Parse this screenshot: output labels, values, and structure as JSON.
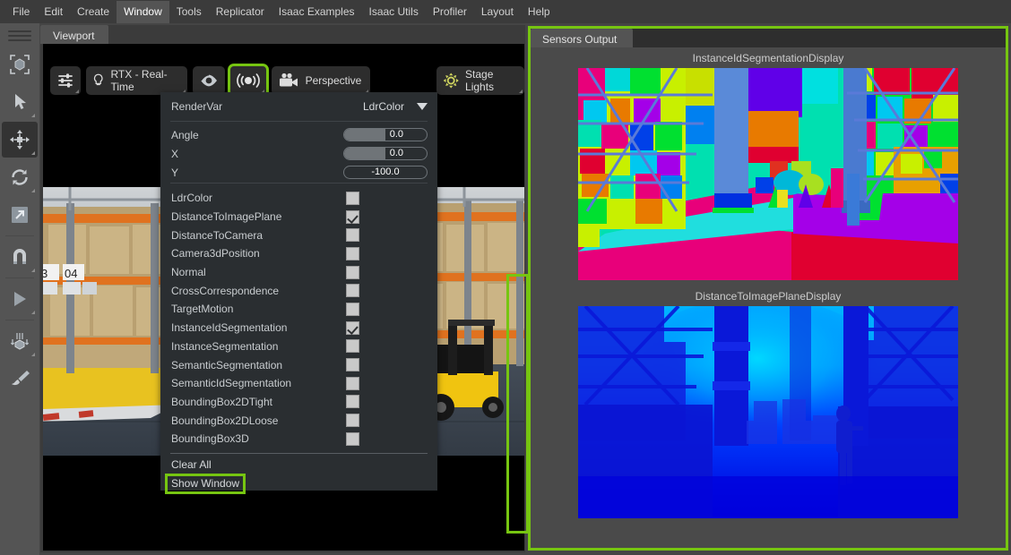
{
  "menubar": {
    "items": [
      {
        "label": "File",
        "active": false
      },
      {
        "label": "Edit",
        "active": false
      },
      {
        "label": "Create",
        "active": false
      },
      {
        "label": "Window",
        "active": true
      },
      {
        "label": "Tools",
        "active": false
      },
      {
        "label": "Replicator",
        "active": false
      },
      {
        "label": "Isaac Examples",
        "active": false
      },
      {
        "label": "Isaac Utils",
        "active": false
      },
      {
        "label": "Profiler",
        "active": false
      },
      {
        "label": "Layout",
        "active": false
      },
      {
        "label": "Help",
        "active": false
      }
    ]
  },
  "left_rail": {
    "items": [
      {
        "icon": "select-bounds-icon",
        "selected": false
      },
      {
        "icon": "arrow-select-icon",
        "selected": false
      },
      {
        "icon": "move-tool-icon",
        "selected": true
      },
      {
        "icon": "rotate-tool-icon",
        "selected": false
      },
      {
        "icon": "scale-tool-icon",
        "selected": false
      },
      {
        "icon": "snap-magnet-icon",
        "selected": false
      },
      {
        "icon": "play-icon",
        "selected": false
      },
      {
        "icon": "physics-drop-icon",
        "selected": false
      },
      {
        "icon": "paint-brush-icon",
        "selected": false
      }
    ]
  },
  "viewport": {
    "tab_label": "Viewport",
    "toolbar": {
      "settings_icon": "sliders-icon",
      "renderer_icon": "lightbulb-icon",
      "renderer_label": "RTX - Real-Time",
      "visibility_icon": "eye-icon",
      "sensor_icon": "sensor-broadcast-icon",
      "sensor_highlighted": true,
      "camera_icon": "camera-icon",
      "camera_label": "Perspective",
      "lighting_icon": "sun-icon",
      "lighting_label": "Stage Lights"
    }
  },
  "rendervar_menu": {
    "header_label": "RenderVar",
    "header_value": "LdrColor",
    "caret_icon": "chevron-down-icon",
    "sliders": [
      {
        "label": "Angle",
        "value": "0.0",
        "fill_pct": 50,
        "centered": false
      },
      {
        "label": "X",
        "value": "0.0",
        "fill_pct": 50,
        "centered": false
      },
      {
        "label": "Y",
        "value": "-100.0",
        "fill_pct": 0,
        "centered": true
      }
    ],
    "options": [
      {
        "label": "LdrColor",
        "checked": false
      },
      {
        "label": "DistanceToImagePlane",
        "checked": true
      },
      {
        "label": "DistanceToCamera",
        "checked": false
      },
      {
        "label": "Camera3dPosition",
        "checked": false
      },
      {
        "label": "Normal",
        "checked": false
      },
      {
        "label": "CrossCorrespondence",
        "checked": false
      },
      {
        "label": "TargetMotion",
        "checked": false
      },
      {
        "label": "InstanceIdSegmentation",
        "checked": true
      },
      {
        "label": "InstanceSegmentation",
        "checked": false
      },
      {
        "label": "SemanticSegmentation",
        "checked": false
      },
      {
        "label": "SemanticIdSegmentation",
        "checked": false
      },
      {
        "label": "BoundingBox2DTight",
        "checked": false
      },
      {
        "label": "BoundingBox2DLoose",
        "checked": false
      },
      {
        "label": "BoundingBox3D",
        "checked": false
      }
    ],
    "clear_all_label": "Clear All",
    "show_window_label": "Show Window",
    "show_window_highlighted": true
  },
  "sensors_output": {
    "tab_label": "Sensors Output",
    "panel_highlighted": true,
    "displays": [
      {
        "title": "InstanceIdSegmentationDisplay",
        "kind": "instance-id-segmentation"
      },
      {
        "title": "DistanceToImagePlaneDisplay",
        "kind": "distance-to-image-plane"
      }
    ]
  },
  "colors": {
    "highlight_green": "#76c511",
    "menubar_bg": "#3b3b3b",
    "rail_bg": "#545454",
    "panel_bg": "#4a4a4a",
    "menu_bg": "#2a2e31",
    "text": "#c9cdd0"
  }
}
